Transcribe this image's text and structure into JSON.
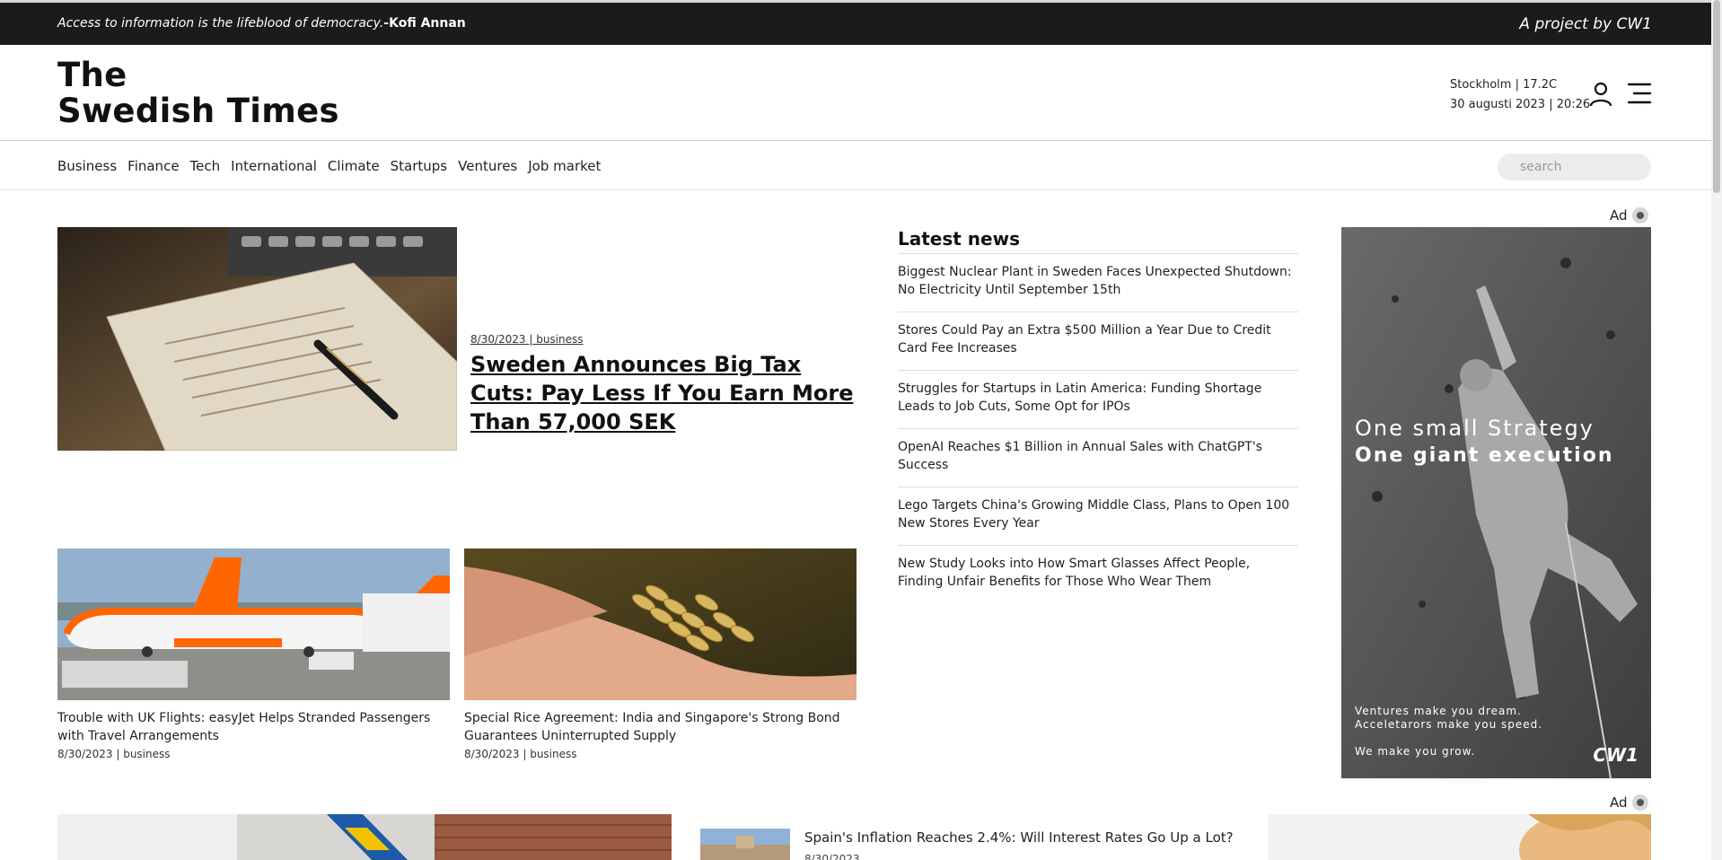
{
  "topbar": {
    "quote_text": "Access to information is the lifeblood of democracy.",
    "quote_author": "-Kofi Annan",
    "project": "A project by CW1"
  },
  "header": {
    "logo_line1": "The",
    "logo_line2": "Swedish Times",
    "weather": "Stockholm | 17.2C",
    "datetime": "30 augusti 2023 | 20:26",
    "user_icon": "user-icon",
    "menu_icon": "hamburger-menu-icon"
  },
  "nav": {
    "links": [
      "Business",
      "Finance",
      "Tech",
      "International",
      "Climate",
      "Startups",
      "Ventures",
      "Job market"
    ],
    "search_placeholder": "search"
  },
  "feature": {
    "meta": "8/30/2023 | business",
    "title": "Sweden Announces Big Tax Cuts: Pay Less If You Earn More Than 57,000 SEK"
  },
  "cards": [
    {
      "title": "Trouble with UK Flights: easyJet Helps Stranded Passengers with Travel Arrangements",
      "meta": "8/30/2023 | business"
    },
    {
      "title": "Special Rice Agreement: India and Singapore's Strong Bond Guarantees Uninterrupted Supply",
      "meta": "8/30/2023 | business"
    }
  ],
  "latest": {
    "heading": "Latest news",
    "items": [
      "Biggest Nuclear Plant in Sweden Faces Unexpected Shutdown: No Electricity Until September 15th",
      "Stores Could Pay an Extra $500 Million a Year Due to Credit Card Fee Increases",
      "Struggles for Startups in Latin America: Funding Shortage Leads to Job Cuts, Some Opt for IPOs",
      "OpenAI Reaches $1 Billion in Annual Sales with ChatGPT's Success",
      "Lego Targets China's Growing Middle Class, Plans to Open 100 New Stores Every Year",
      "New Study Looks into How Smart Glasses Affect People, Finding Unfair Benefits for Those Who Wear Them"
    ]
  },
  "ads": {
    "label": "Ad",
    "ad1_line1": "One small Strategy",
    "ad1_line2": "One giant execution",
    "ad1_sub1": "Ventures make you dream.",
    "ad1_sub2": "Acceletarors make you speed.",
    "ad1_sub3": "We make you grow.",
    "ad1_brand": "CW1"
  },
  "bottom": {
    "title": "Spain's Inflation Reaches 2.4%: Will Interest Rates Go Up a Lot?",
    "meta": "8/30/2023"
  }
}
